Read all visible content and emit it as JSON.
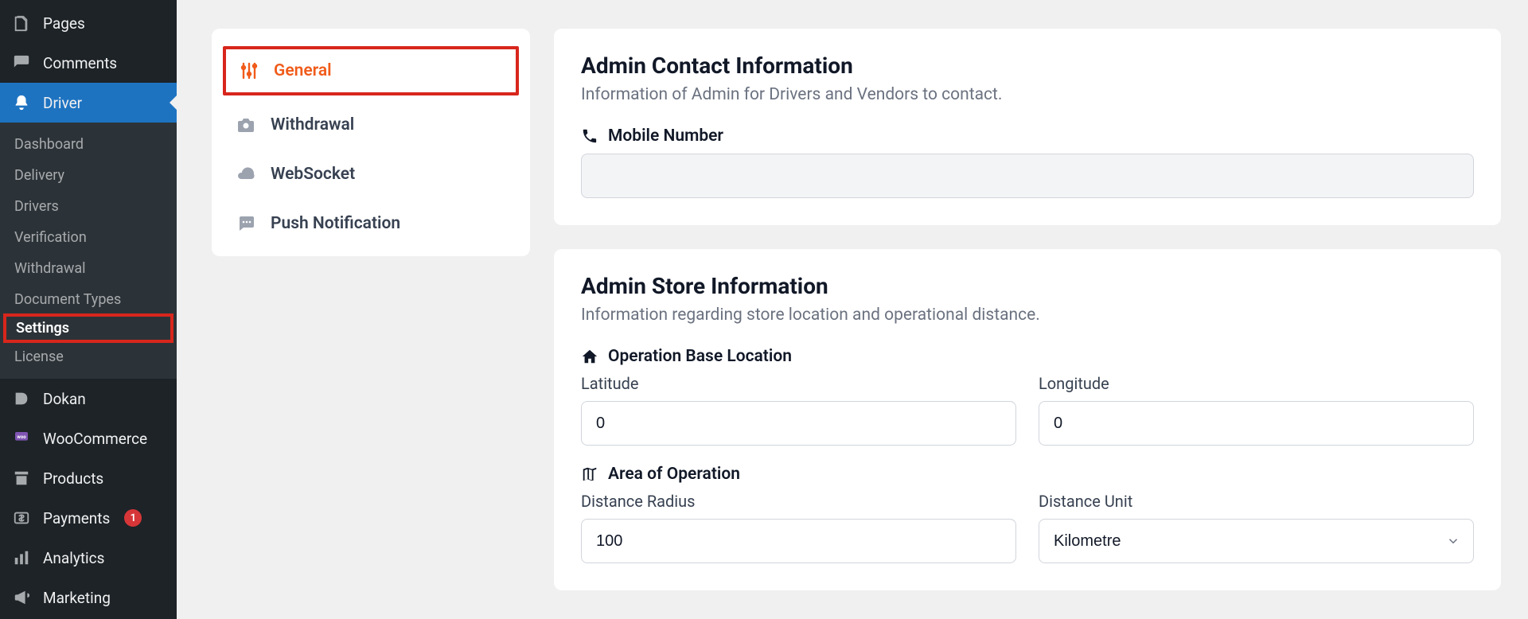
{
  "sidebar": {
    "top": [
      {
        "label": "Pages",
        "name": "pages-item",
        "icon": "pages-icon"
      },
      {
        "label": "Comments",
        "name": "comments-item",
        "icon": "comment-icon"
      },
      {
        "label": "Driver",
        "name": "driver-item",
        "icon": "bell-icon",
        "active": true
      }
    ],
    "driver_sub": [
      {
        "label": "Dashboard",
        "name": "driver-sub-dashboard"
      },
      {
        "label": "Delivery",
        "name": "driver-sub-delivery"
      },
      {
        "label": "Drivers",
        "name": "driver-sub-drivers"
      },
      {
        "label": "Verification",
        "name": "driver-sub-verification"
      },
      {
        "label": "Withdrawal",
        "name": "driver-sub-withdrawal"
      },
      {
        "label": "Document Types",
        "name": "driver-sub-doctypes"
      },
      {
        "label": "Settings",
        "name": "driver-sub-settings",
        "current": true,
        "highlight": true
      },
      {
        "label": "License",
        "name": "driver-sub-license"
      }
    ],
    "bottom": [
      {
        "label": "Dokan",
        "name": "dokan-item",
        "icon": "dokan-icon"
      },
      {
        "label": "WooCommerce",
        "name": "woocommerce-item",
        "icon": "woo-icon"
      },
      {
        "label": "Products",
        "name": "products-item",
        "icon": "archive-icon"
      },
      {
        "label": "Payments",
        "name": "payments-item",
        "icon": "payments-icon",
        "badge": "1"
      },
      {
        "label": "Analytics",
        "name": "analytics-item",
        "icon": "analytics-icon"
      },
      {
        "label": "Marketing",
        "name": "marketing-item",
        "icon": "megaphone-icon"
      }
    ]
  },
  "tabs": [
    {
      "label": "General",
      "name": "tab-general",
      "icon": "sliders-icon",
      "selected": true
    },
    {
      "label": "Withdrawal",
      "name": "tab-withdrawal",
      "icon": "camera-icon"
    },
    {
      "label": "WebSocket",
      "name": "tab-websocket",
      "icon": "cloud-icon"
    },
    {
      "label": "Push Notification",
      "name": "tab-push",
      "icon": "chat-icon"
    }
  ],
  "card_contact": {
    "title": "Admin Contact Information",
    "desc": "Information of Admin for Drivers and Vendors to contact.",
    "mobile_label": "Mobile Number",
    "mobile_value": ""
  },
  "card_store": {
    "title": "Admin Store Information",
    "desc": "Information regarding store location and operational distance.",
    "loc_head": "Operation Base Location",
    "lat_label": "Latitude",
    "lat_value": "0",
    "lon_label": "Longitude",
    "lon_value": "0",
    "area_head": "Area of Operation",
    "radius_label": "Distance Radius",
    "radius_value": "100",
    "unit_label": "Distance Unit",
    "unit_value": "Kilometre"
  }
}
